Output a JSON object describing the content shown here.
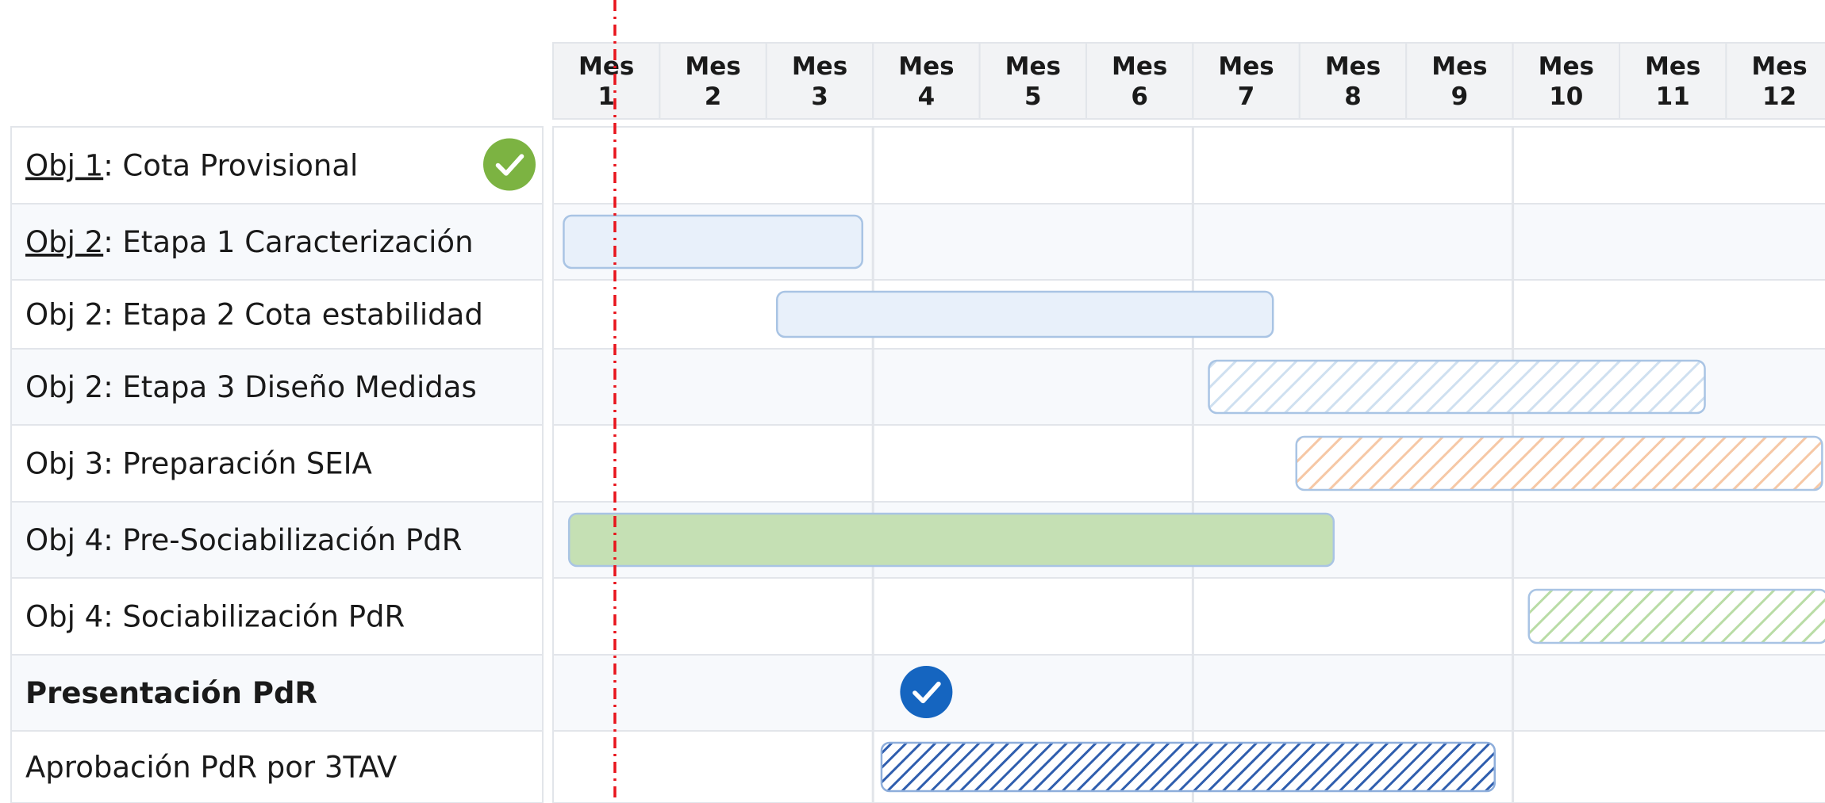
{
  "chart_data": {
    "type": "gantt",
    "months": [
      {
        "word": "Mes",
        "num": "1"
      },
      {
        "word": "Mes",
        "num": "2"
      },
      {
        "word": "Mes",
        "num": "3"
      },
      {
        "word": "Mes",
        "num": "4"
      },
      {
        "word": "Mes",
        "num": "5"
      },
      {
        "word": "Mes",
        "num": "6"
      },
      {
        "word": "Mes",
        "num": "7"
      },
      {
        "word": "Mes",
        "num": "8"
      },
      {
        "word": "Mes",
        "num": "9"
      },
      {
        "word": "Mes",
        "num": "10"
      },
      {
        "word": "Mes",
        "num": "11"
      },
      {
        "word": "Mes",
        "num": "12"
      }
    ],
    "today_marker_month": 1.3,
    "tasks": [
      {
        "prefix": "Obj 1",
        "prefix_underlined": true,
        "rest": ": Cota Provisional",
        "bold": false,
        "status": "completed",
        "bar": null
      },
      {
        "prefix": "Obj 2",
        "prefix_underlined": true,
        "rest": ": Etapa 1 Caracterización",
        "bold": false,
        "bar": {
          "start": 0.1,
          "end": 2.9,
          "style": "solid",
          "color": "#e8f0fa",
          "border": "#a9c4e4"
        }
      },
      {
        "prefix": "",
        "prefix_underlined": false,
        "rest": "Obj 2: Etapa 2 Cota estabilidad",
        "bold": false,
        "bar": {
          "start": 2.1,
          "end": 6.75,
          "style": "solid",
          "color": "#e8f0fa",
          "border": "#a9c4e4"
        }
      },
      {
        "prefix": "",
        "prefix_underlined": false,
        "rest": "Obj 2: Etapa 3 Diseño Medidas",
        "bold": false,
        "bar": {
          "start": 6.15,
          "end": 10.8,
          "style": "hatched",
          "color": "#cfe0f0",
          "border": "#a9c4e4"
        }
      },
      {
        "prefix": "",
        "prefix_underlined": false,
        "rest": "Obj 3: Preparación SEIA",
        "bold": false,
        "bar": {
          "start": 6.97,
          "end": 11.9,
          "style": "hatched",
          "color": "#f6c8a6",
          "border": "#a9c4e4"
        }
      },
      {
        "prefix": "",
        "prefix_underlined": false,
        "rest": "Obj 4: Pre-Sociabilización PdR",
        "bold": false,
        "bar": {
          "start": 0.15,
          "end": 7.32,
          "style": "solid",
          "color": "#c5e0b4",
          "border": "#a9c4e4"
        }
      },
      {
        "prefix": "",
        "prefix_underlined": false,
        "rest": "Obj 4: Sociabilización PdR",
        "bold": false,
        "bar": {
          "start": 9.15,
          "end": 11.95,
          "style": "hatched",
          "color": "#b9dca6",
          "border": "#a9c4e4"
        }
      },
      {
        "prefix": "",
        "prefix_underlined": false,
        "rest": "Presentación PdR",
        "bold": true,
        "milestone_month": 3.5,
        "bar": null
      },
      {
        "prefix": "",
        "prefix_underlined": false,
        "rest": "Aprobación PdR por 3TAV",
        "bold": false,
        "bar": {
          "start": 3.08,
          "end": 8.83,
          "style": "hatched-dense",
          "color": "#2f5eae",
          "border": "#8eaedb"
        }
      }
    ],
    "colors": {
      "completed_check": "#7cb342",
      "milestone_check": "#1565c0",
      "today_line": "#e8141c",
      "grid": "#e2e5ea",
      "header_fill": "#f2f3f5",
      "row_alt_fill": "#f7f9fc"
    },
    "icons": {
      "completed": "check-circle-icon",
      "milestone": "check-circle-icon"
    }
  }
}
